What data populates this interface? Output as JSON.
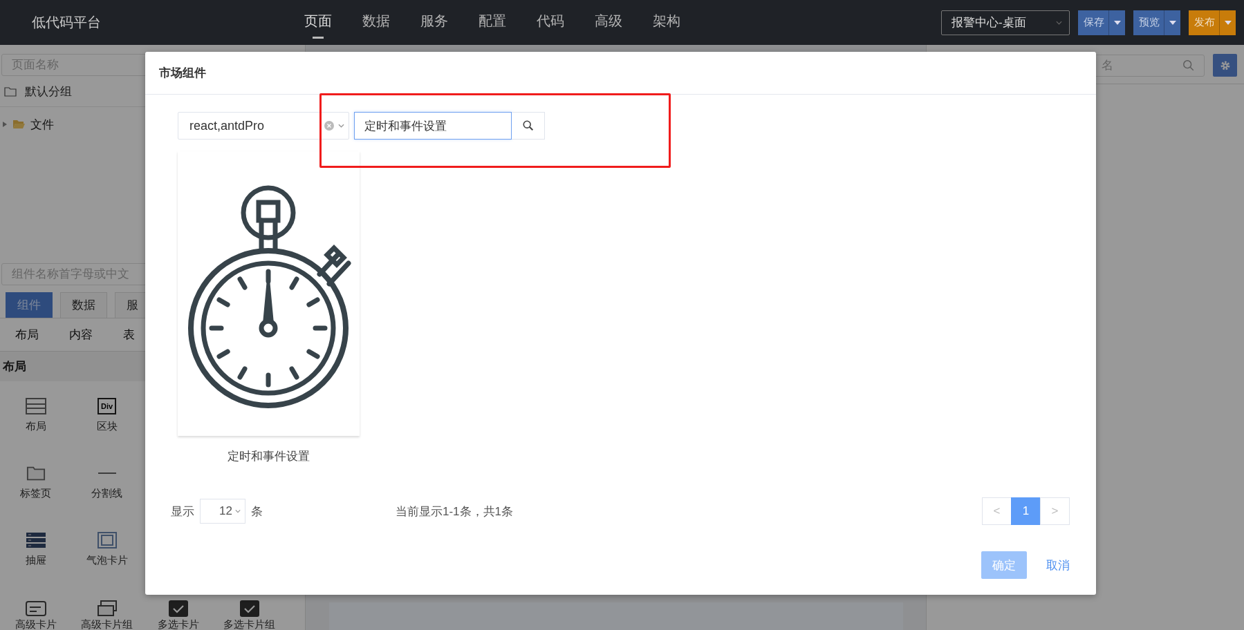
{
  "header": {
    "logo": "低代码平台",
    "nav": [
      {
        "label": "页面",
        "selected": true
      },
      {
        "label": "数据",
        "selected": false
      },
      {
        "label": "服务",
        "selected": false
      },
      {
        "label": "配置",
        "selected": false
      },
      {
        "label": "代码",
        "selected": false
      },
      {
        "label": "高级",
        "selected": false
      },
      {
        "label": "架构",
        "selected": false
      }
    ],
    "page_select": "报警中心-桌面",
    "buttons": [
      {
        "label": "保存",
        "kind": "primary"
      },
      {
        "label": "预览",
        "kind": "primary"
      },
      {
        "label": "发布",
        "kind": "warning"
      }
    ]
  },
  "left_panel": {
    "page_search": {
      "placeholder": "页面名称"
    },
    "group": "默认分组",
    "tree": [
      {
        "label": "文件",
        "expanded": false
      }
    ],
    "component_search": {
      "placeholder": "组件名称首字母或中文"
    },
    "tabs": [
      {
        "label": "组件",
        "selected": true
      },
      {
        "label": "数据",
        "selected": false
      },
      {
        "label": "服",
        "selected": false
      }
    ],
    "categories": [
      "布局",
      "内容",
      "表"
    ],
    "section": "布局",
    "components": [
      {
        "label": "布局",
        "kind": "layout"
      },
      {
        "label": "区块",
        "kind": "div",
        "icon_text": "Div"
      },
      {
        "label": "标签页",
        "kind": "tabs"
      },
      {
        "label": "分割线",
        "kind": "divider"
      },
      {
        "label": "抽屉",
        "kind": "drawer"
      },
      {
        "label": "气泡卡片",
        "kind": "popover"
      },
      {
        "label": "高级卡片",
        "kind": "card"
      },
      {
        "label": "高级卡片组",
        "kind": "card-group"
      },
      {
        "label": "多选卡片",
        "kind": "check"
      },
      {
        "label": "多选卡片组",
        "kind": "check"
      }
    ]
  },
  "right_panel": {
    "search": {
      "placeholder": "名"
    }
  },
  "modal": {
    "title": "市场组件",
    "filter": {
      "value": "react,antdPro"
    },
    "search": {
      "value": "定时和事件设置"
    },
    "results": [
      {
        "label": "定时和事件设置"
      }
    ],
    "page_size": {
      "before": "显示",
      "value": "12",
      "after": "条"
    },
    "summary": "当前显示1-1条，共1条",
    "pagination": {
      "prev": "<",
      "pages": [
        {
          "label": "1",
          "selected": true
        }
      ],
      "next": ">",
      "prev_disabled": true,
      "next_disabled": true
    },
    "ok": {
      "label": "确定",
      "disabled": true
    },
    "cancel": "取消"
  }
}
